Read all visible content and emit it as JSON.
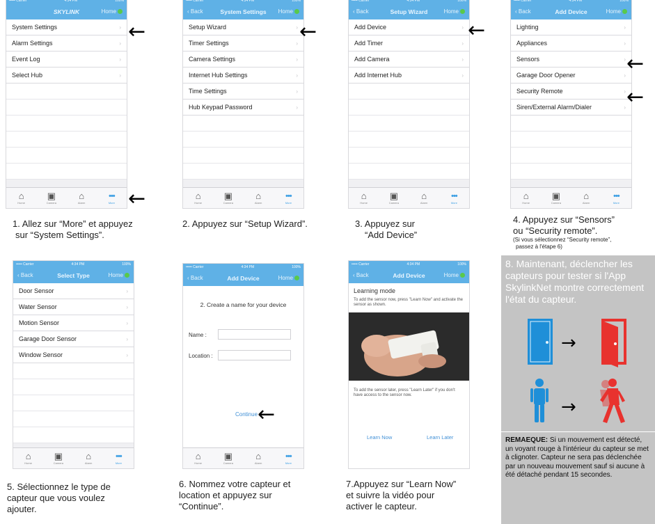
{
  "status": {
    "carrier": "••••• Carrier",
    "time": "4:34 PM",
    "battery": "100%"
  },
  "common": {
    "back": "Back",
    "home": "Home",
    "chevron": "›"
  },
  "tabs": [
    {
      "label": "Home",
      "icon": "home-icon"
    },
    {
      "label": "Camera",
      "icon": "camera-icon"
    },
    {
      "label": "Alarm",
      "icon": "alarm-icon"
    },
    {
      "label": "More",
      "icon": "more-icon"
    }
  ],
  "screen1": {
    "title": "SKYLINK",
    "rows": [
      "System Settings",
      "Alarm Settings",
      "Event Log",
      "Select Hub"
    ]
  },
  "screen2": {
    "title": "System Settings",
    "rows": [
      "Setup Wizard",
      "Timer Settings",
      "Camera Settings",
      "Internet Hub Settings",
      "Time Settings",
      "Hub Keypad Password"
    ]
  },
  "screen3": {
    "title": "Setup Wizard",
    "rows": [
      "Add Device",
      "Add Timer",
      "Add Camera",
      "Add Internet Hub"
    ]
  },
  "screen4": {
    "title": "Add Device",
    "rows": [
      "Lighting",
      "Appliances",
      "Sensors",
      "Garage Door Opener",
      "Security Remote",
      "Siren/External Alarm/Dialer"
    ]
  },
  "screen5": {
    "title": "Select Type",
    "rows": [
      "Door Sensor",
      "Water Sensor",
      "Motion Sensor",
      "Garage Door Sensor",
      "Window Sensor"
    ]
  },
  "screen6": {
    "title": "Add Device",
    "heading": "2. Create a name for your device",
    "name_label": "Name :",
    "location_label": "Location :",
    "continue": "Continue"
  },
  "screen7": {
    "title": "Add Device",
    "heading": "Learning mode",
    "text1": "To add the sensor now, press \"Learn Now\" and activate the sensor as shown.",
    "text2": "To add the sensor later, press \"Learn Later\" if you don't have access to the sensor now.",
    "learn_now": "Learn Now",
    "learn_later": "Learn Later"
  },
  "captions": {
    "c1a": "1. Allez sur “More” et appuyez",
    "c1b": "sur “System Settings”.",
    "c2": "2. Appuyez sur “Setup Wizard”.",
    "c3a": "3. Appuyez sur",
    "c3b": "“Add Device”",
    "c4a": "4. Appuyez sur “Sensors”",
    "c4b": "ou “Security remote”.",
    "c4c": "(Si vous sélectionnez “Security remote”,",
    "c4d": "passez à l'étape 6)",
    "c5a": "5. Sélectionnez le type de",
    "c5b": "capteur que vous voulez",
    "c5c": "ajouter.",
    "c6a": "6. Nommez votre capteur et",
    "c6b": "location et appuyez sur",
    "c6c": "“Continue”.",
    "c7a": "7.Appuyez sur “Learn Now”",
    "c7b": "et suivre la vidéo pour",
    "c7c": "activer le capteur."
  },
  "panel8": {
    "text": "8. Maintenant, déclencher les capteurs pour tester si l'App SkylinkNet montre correctement l'état du capteur.",
    "arrow": "→"
  },
  "remark": {
    "label": "REMAEQUE:",
    "text": " Si un mouvement est détecté, un voyant rouge à l'intérieur du capteur se met à clignoter. Capteur ne sera pas déclenchée par un nouveau mouvement sauf si aucune à été détaché pendant 15 secondes."
  },
  "pointer": "←",
  "colors": {
    "nav_blue": "#5fb1e6",
    "online_green": "#59c94a",
    "door_blue": "#1f8fd8",
    "alarm_red": "#e8322e",
    "panel_gray": "#c4c4c4"
  }
}
